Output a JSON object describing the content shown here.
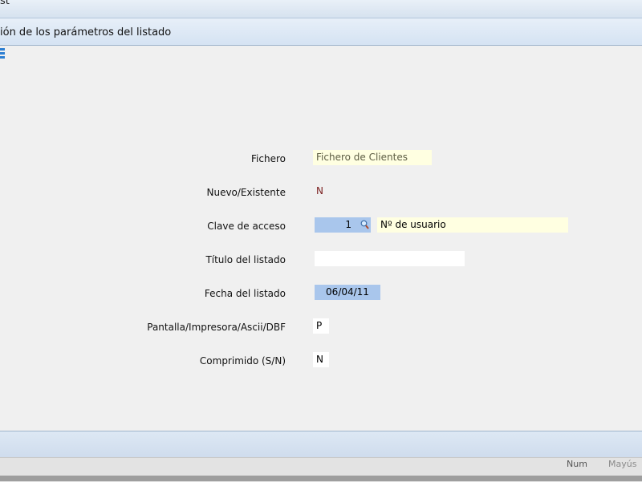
{
  "window": {
    "title": "st"
  },
  "panel": {
    "title": "ión de los parámetros del listado"
  },
  "form": {
    "fichero": {
      "label": "Fichero",
      "value": "Fichero de Clientes"
    },
    "nuevo": {
      "label": "Nuevo/Existente",
      "value": "N"
    },
    "clave": {
      "label": "Clave de acceso",
      "value": "1",
      "description": "Nº de usuario"
    },
    "titulo": {
      "label": "Título del listado",
      "value": ""
    },
    "fecha": {
      "label": "Fecha del listado",
      "value": "06/04/11"
    },
    "pantalla": {
      "label": "Pantalla/Impresora/Ascii/DBF",
      "value": "P"
    },
    "comprimido": {
      "label": "Comprimido (S/N)",
      "value": "N"
    }
  },
  "statusbar": {
    "num": "Num",
    "caps": "Mayús"
  },
  "colors": {
    "accent_blue": "#a9c6ec",
    "tooltip_yellow": "#ffffe1"
  }
}
